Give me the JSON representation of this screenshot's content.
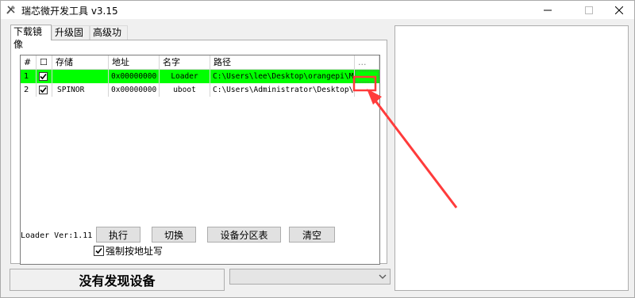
{
  "window": {
    "title": "瑞芯微开发工具 v3.15",
    "icon": "tools-icon",
    "min_icon": "minimize-icon",
    "max_icon": "maximize-icon",
    "close_icon": "close-icon"
  },
  "tabs": [
    {
      "label": "下载镜像",
      "active": true
    },
    {
      "label": "升级固件",
      "active": false
    },
    {
      "label": "高级功能",
      "active": false
    }
  ],
  "table": {
    "headers": {
      "index": "#",
      "check": "☐",
      "storage": "存储",
      "address": "地址",
      "name": "名字",
      "path": "路径",
      "more": "..."
    },
    "rows": [
      {
        "index": "1",
        "checked": true,
        "storage": "",
        "address": "0x00000000",
        "name": "Loader",
        "path": "C:\\Users\\lee\\Desktop\\orangepi\\M...",
        "highlight_color": "#00ff00"
      },
      {
        "index": "2",
        "checked": true,
        "storage": "SPINOR",
        "address": "0x00000000",
        "name": "uboot",
        "path": "C:\\Users\\Administrator\\Desktop\\...",
        "highlight_color": "#ffffff"
      }
    ]
  },
  "loader_version": "Loader Ver:1.11",
  "buttons": {
    "execute": "执行",
    "switch": "切换",
    "partition": "设备分区表",
    "clear": "清空"
  },
  "force_address_write": {
    "label": "强制按地址写",
    "checked": true
  },
  "status": "没有发现设备",
  "device_combo": {
    "value": ""
  },
  "annotation_color": "#ff3b3b"
}
